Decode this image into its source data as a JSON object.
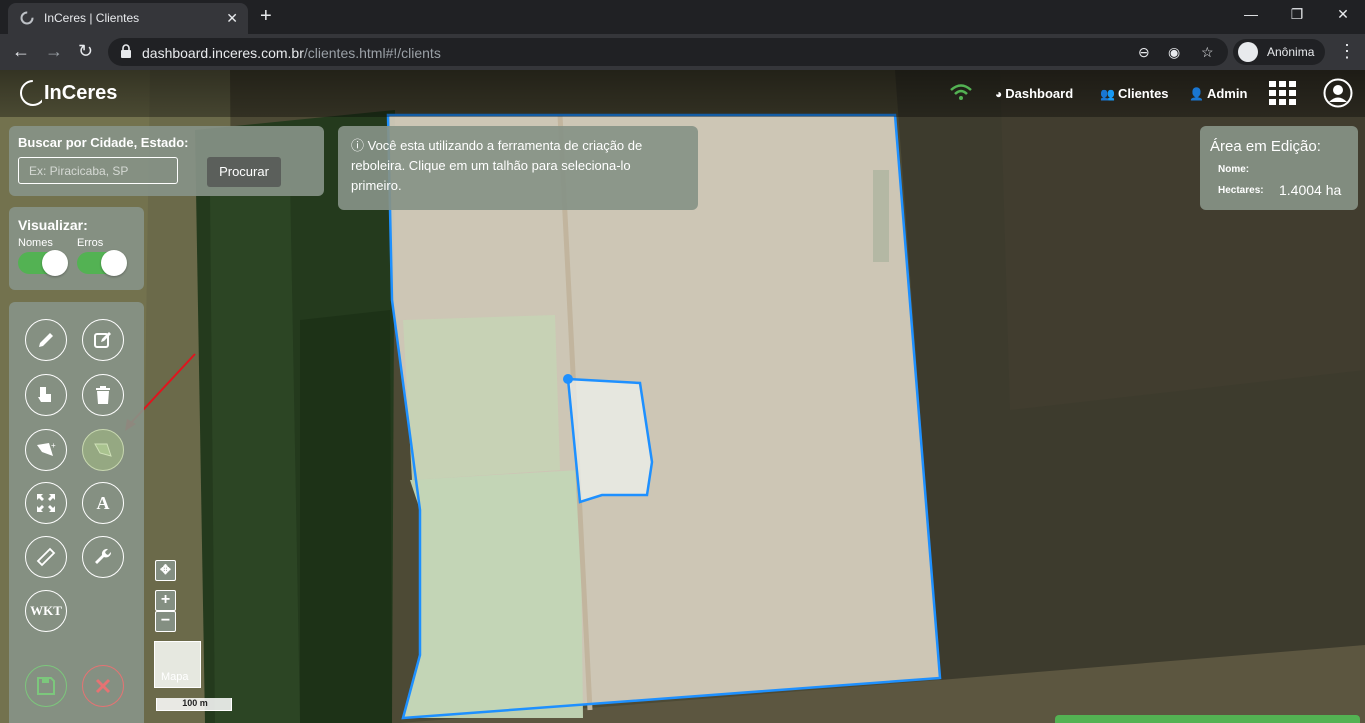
{
  "browser": {
    "tab_title": "InCeres | Clientes",
    "url_domain": "dashboard.inceres.com.br",
    "url_path": "/clientes.html#!/clients",
    "profile_name": "Anônima"
  },
  "header": {
    "logo": "InCeres",
    "nav": [
      {
        "label": "Dashboard",
        "icon": "dashboard-icon"
      },
      {
        "label": "Clientes",
        "icon": "users-icon"
      },
      {
        "label": "Admin",
        "icon": "user-plus-icon"
      }
    ]
  },
  "search": {
    "label": "Buscar por Cidade, Estado:",
    "placeholder": "Ex: Piracicaba, SP",
    "button": "Procurar"
  },
  "info": {
    "message": "Você esta utilizando a ferramenta de criação de reboleira. Clique em um talhão para seleciona-lo primeiro."
  },
  "visualizar": {
    "label": "Visualizar:",
    "toggles": [
      {
        "label": "Nomes",
        "on": true
      },
      {
        "label": "Erros",
        "on": true
      }
    ]
  },
  "tools": [
    {
      "name": "pencil-icon"
    },
    {
      "name": "edit-icon"
    },
    {
      "name": "hand-pointer-icon"
    },
    {
      "name": "trash-icon"
    },
    {
      "name": "polygon-add-icon"
    },
    {
      "name": "polygon-selected-icon",
      "active": true
    },
    {
      "name": "expand-arrows-icon"
    },
    {
      "name": "font-icon",
      "label": "A"
    },
    {
      "name": "ruler-icon"
    },
    {
      "name": "wrench-icon"
    },
    {
      "name": "wkt-icon",
      "label": "WKT"
    },
    {
      "name": "save-icon"
    },
    {
      "name": "cancel-icon"
    }
  ],
  "area": {
    "title": "Área em Edição:",
    "name_label": "Nome:",
    "hectares_label": "Hectares:",
    "hectares_value": "1.4004 ha"
  },
  "map": {
    "layer_label": "Mapa",
    "scale_label": "100 m"
  },
  "colors": {
    "accent_green": "#53b253",
    "panel": "#879287",
    "polygon_stroke": "#1e90ff"
  }
}
